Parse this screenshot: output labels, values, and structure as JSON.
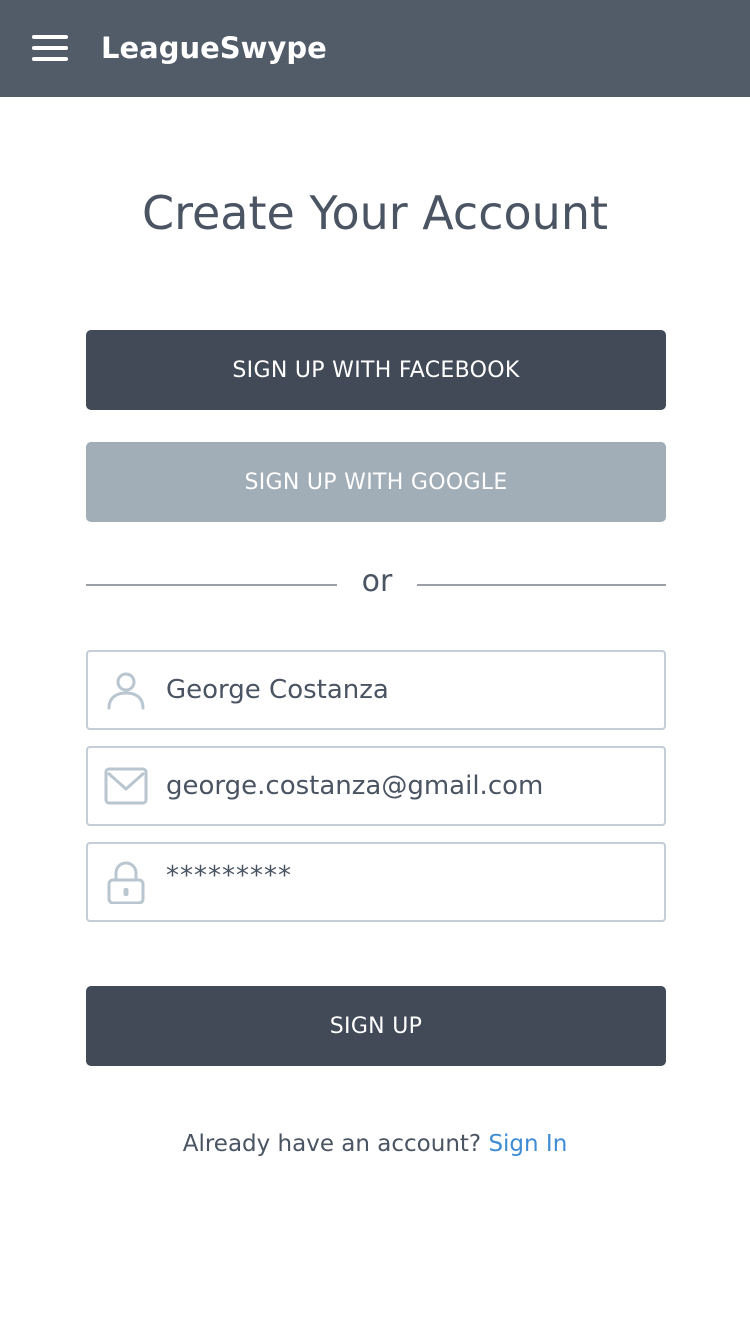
{
  "header": {
    "menu_icon": "hamburger-menu-icon",
    "brand": "LeagueSwype"
  },
  "page": {
    "title": "Create Your Account"
  },
  "social": {
    "facebook_label": "SIGN UP WITH FACEBOOK",
    "google_label": "SIGN UP WITH GOOGLE"
  },
  "divider": {
    "text": "or"
  },
  "form": {
    "name": {
      "icon": "person-icon",
      "value": "George Costanza"
    },
    "email": {
      "icon": "envelope-icon",
      "value": "george.costanza@gmail.com"
    },
    "password": {
      "icon": "lock-icon",
      "value": "*********"
    },
    "submit_label": "SIGN UP"
  },
  "footer": {
    "prompt": "Already have an account?",
    "link_label": "Sign In"
  },
  "colors": {
    "header_bg": "#525c69",
    "primary_button": "#424a58",
    "google_button": "#a1adb7",
    "link": "#3f8bd4",
    "field_border": "#c5ced6",
    "icon": "#b9c6d0"
  }
}
